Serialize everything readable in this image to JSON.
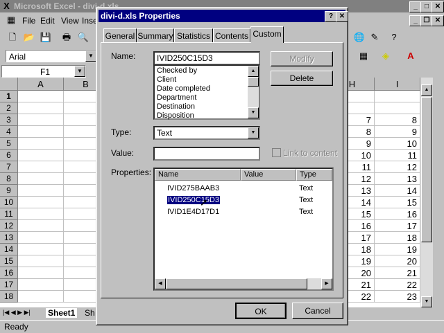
{
  "excel": {
    "title": "Microsoft Excel - divi-d.xls",
    "menu": [
      "File",
      "Edit",
      "View",
      "Inse"
    ],
    "font": "Arial",
    "name_box": "F1",
    "columns_left": [
      "A",
      "B"
    ],
    "columns_right": [
      "H",
      "I"
    ],
    "rows": [
      "1",
      "2",
      "3",
      "4",
      "5",
      "6",
      "7",
      "8",
      "9",
      "10",
      "11",
      "12",
      "13",
      "14",
      "15",
      "16",
      "17",
      "18"
    ],
    "col_h": [
      "",
      "",
      "7",
      "8",
      "9",
      "10",
      "11",
      "12",
      "13",
      "14",
      "15",
      "16",
      "17",
      "18",
      "19",
      "20",
      "21",
      "22"
    ],
    "col_i": [
      "",
      "",
      "8",
      "9",
      "10",
      "11",
      "12",
      "13",
      "14",
      "15",
      "16",
      "17",
      "18",
      "19",
      "20",
      "21",
      "22",
      "23"
    ],
    "sheet_tab": "Sheet1",
    "sheet_tab2": "Sh",
    "status": "Ready"
  },
  "dialog": {
    "title": "divi-d.xls Properties",
    "help": "?",
    "close": "✕",
    "tabs": [
      "General",
      "Summary",
      "Statistics",
      "Contents",
      "Custom"
    ],
    "name_label": "Name:",
    "name_value": "IVID250C15D3",
    "name_list": [
      "Checked by",
      "Client",
      "Date completed",
      "Department",
      "Destination",
      "Disposition"
    ],
    "modify": "Modify",
    "delete": "Delete",
    "type_label": "Type:",
    "type_value": "Text",
    "value_label": "Value:",
    "value_value": "",
    "link_to_content": "Link to content",
    "properties_label": "Properties:",
    "columns": [
      "Name",
      "Value",
      "Type"
    ],
    "properties": [
      {
        "name": "IVID275BAAB3",
        "value": "",
        "type": "Text"
      },
      {
        "name": "IVID250C15D3",
        "value": "",
        "type": "Text"
      },
      {
        "name": "IVID1E4D17D1",
        "value": "",
        "type": "Text"
      }
    ],
    "ok": "OK",
    "cancel": "Cancel"
  }
}
